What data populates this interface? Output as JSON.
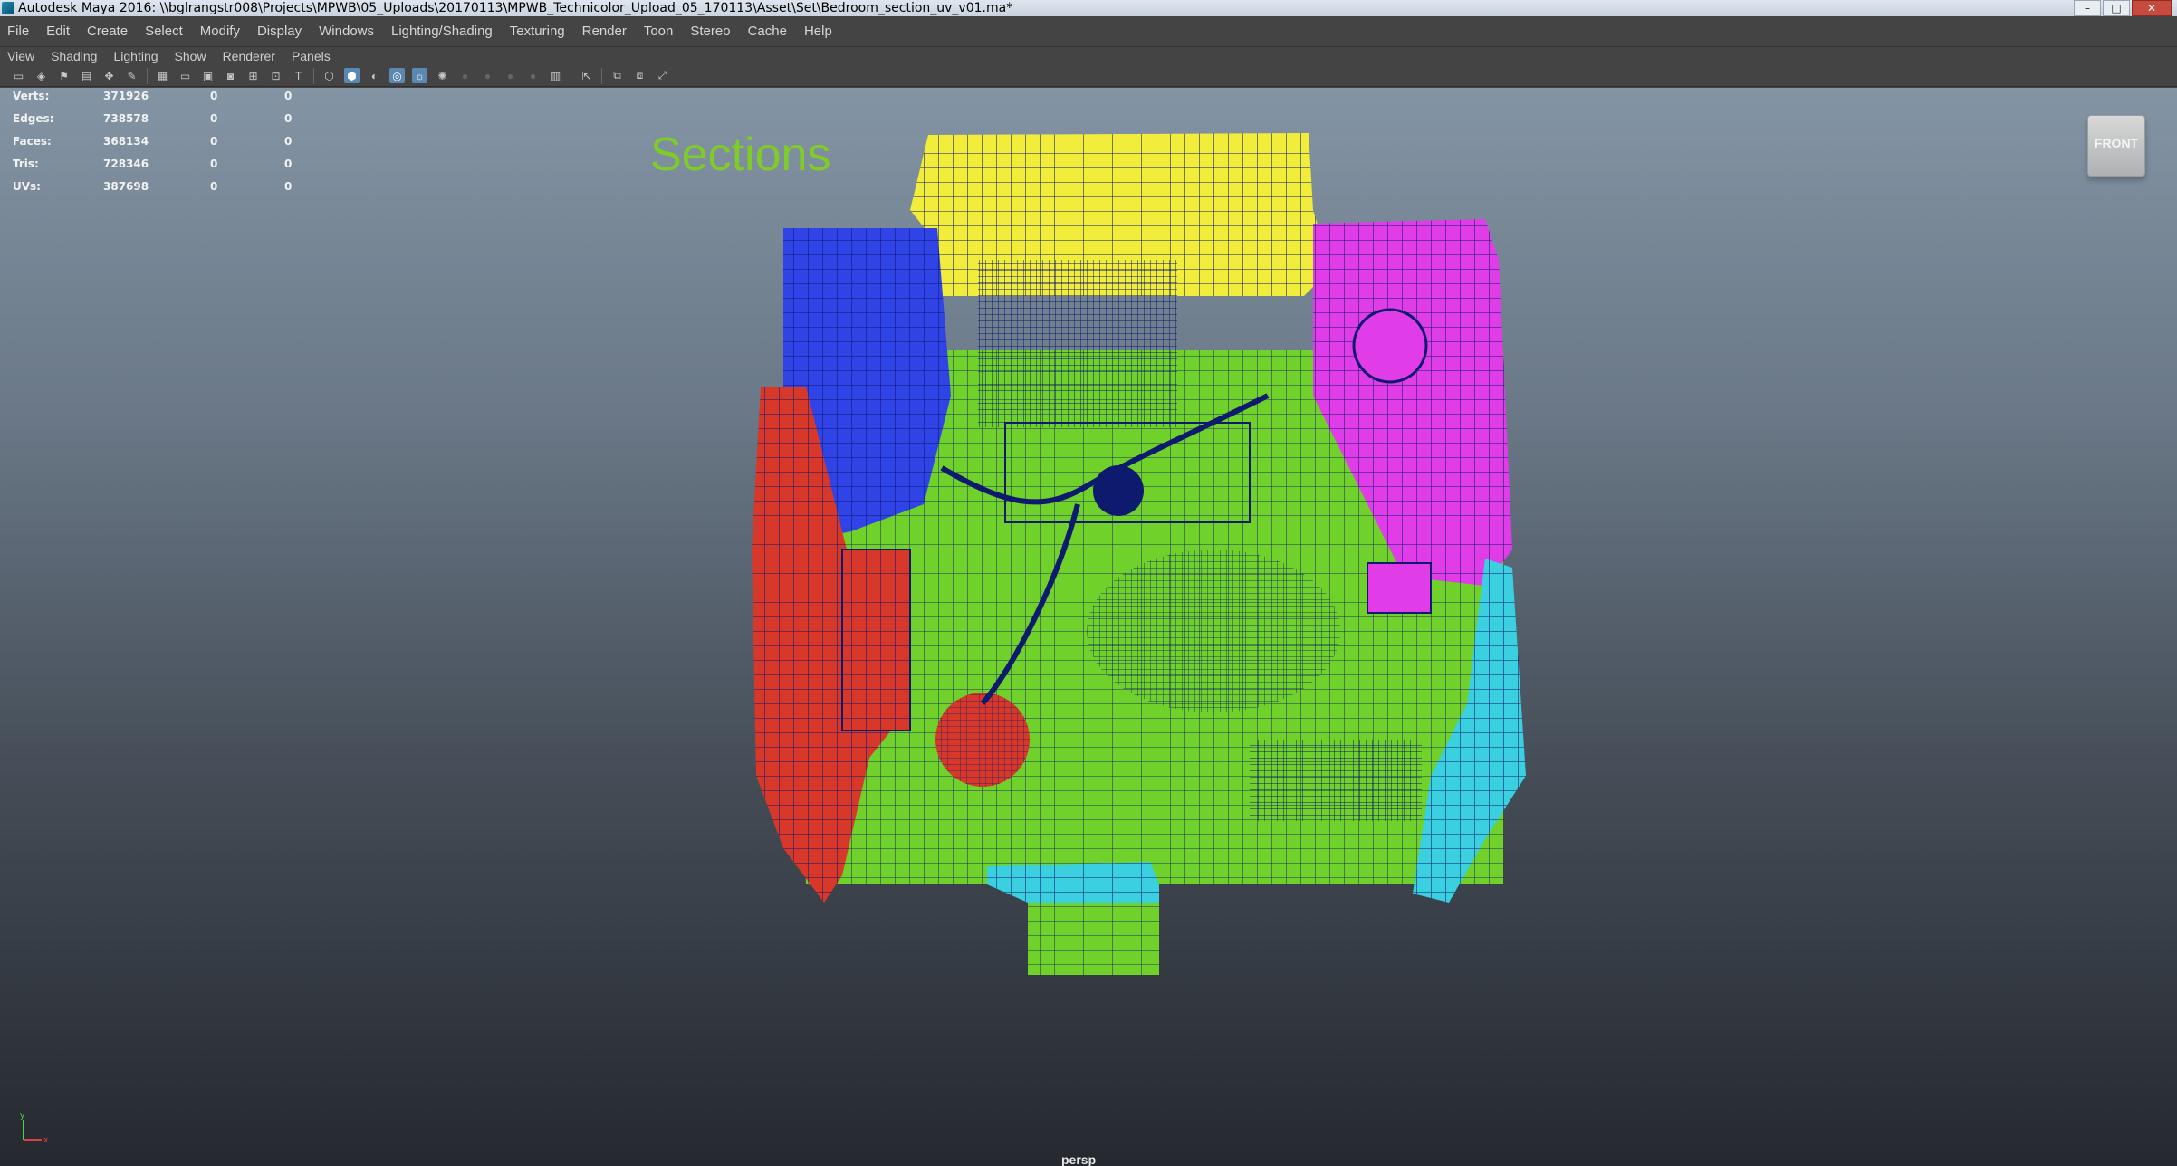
{
  "window": {
    "title": "Autodesk Maya 2016: \\\\bglrangstr008\\Projects\\MPWB\\05_Uploads\\20170113\\MPWB_Technicolor_Upload_05_170113\\Asset\\Set\\Bedroom_section_uv_v01.ma*",
    "controls": {
      "minimize": "–",
      "maximize": "□",
      "close": "✕"
    }
  },
  "menubar": [
    "File",
    "Edit",
    "Create",
    "Select",
    "Modify",
    "Display",
    "Windows",
    "Lighting/Shading",
    "Texturing",
    "Render",
    "Toon",
    "Stereo",
    "Cache",
    "Help"
  ],
  "panel_menu": [
    "View",
    "Shading",
    "Lighting",
    "Show",
    "Renderer",
    "Panels"
  ],
  "toolbar_icons": [
    "select-camera-icon",
    "camera-attributes-icon",
    "bookmark-icon",
    "image-plane-icon",
    "two-d-pan-icon",
    "grease-pencil-icon",
    "grid-icon",
    "film-gate-icon",
    "resolution-gate-icon",
    "gate-mask-icon",
    "field-chart-icon",
    "safe-action-icon",
    "safe-title-icon",
    "wireframe-icon",
    "smooth-shade-icon",
    "wireframe-on-shaded-icon",
    "textured-icon",
    "use-all-lights-icon",
    "shadows-icon",
    "screen-space-ao-icon",
    "motion-blur-icon",
    "multisample-aa-icon",
    "depth-of-field-icon",
    "isolate-select-icon",
    "xray-icon",
    "xray-joints-icon",
    "backface-culling-icon"
  ],
  "hud": {
    "rows": [
      {
        "label": "Verts:",
        "v1": "371926",
        "v2": "0",
        "v3": "0"
      },
      {
        "label": "Edges:",
        "v1": "738578",
        "v2": "0",
        "v3": "0"
      },
      {
        "label": "Faces:",
        "v1": "368134",
        "v2": "0",
        "v3": "0"
      },
      {
        "label": "Tris:",
        "v1": "728346",
        "v2": "0",
        "v3": "0"
      },
      {
        "label": "UVs:",
        "v1": "387698",
        "v2": "0",
        "v3": "0"
      }
    ]
  },
  "viewport": {
    "annotation": "Sections",
    "viewcube": "FRONT",
    "camera": "persp",
    "axis": {
      "x": "x",
      "y": "y"
    }
  },
  "colors": {
    "section_floor": "#6fd12a",
    "section_back": "#f2ec3a",
    "section_left": "#2f43e6",
    "section_right": "#e03ce8",
    "section_front": "#3ad0e0",
    "section_left_wall": "#d8382a",
    "wireframe": "#0d1a6e"
  }
}
